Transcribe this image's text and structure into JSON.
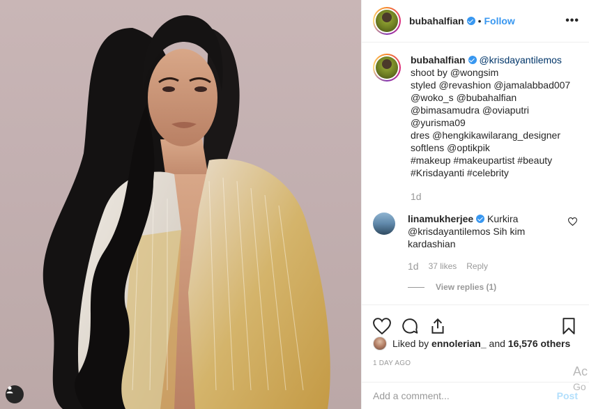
{
  "post": {
    "username": "bubahalfian",
    "follow_label": "Follow",
    "separator": "•",
    "more_label": "•••"
  },
  "caption": {
    "username": "bubahalfian",
    "lines": [
      "@krisdayantilemos",
      "shoot by @wongsim",
      "styled @revashion @jamalabbad007",
      "@woko_s @bubahalfian",
      "@bimasamudra @oviaputri",
      "@yurisma09",
      "dres @hengkikawilarang_designer",
      "softlens @optikpik",
      "#makeup #makeupartist #beauty",
      "#Krisdayanti #celebrity"
    ],
    "time": "1d"
  },
  "comment": {
    "username": "linamukherjee",
    "text_line1": "Kurkira",
    "text_line2": "@krisdayantilemos Sih kim",
    "text_line3": "kardashian",
    "time": "1d",
    "likes": "37 likes",
    "reply_label": "Reply",
    "view_replies": "View replies (1)"
  },
  "likes": {
    "prefix": "Liked by",
    "user": "ennolerian_",
    "and": "and",
    "count": "16,576 others"
  },
  "date": "1 DAY AGO",
  "add_comment": {
    "placeholder": "Add a comment...",
    "post_label": "Post"
  },
  "watermark": {
    "line1": "Ac",
    "line2": "Go"
  },
  "colors": {
    "link": "#3897f0",
    "mention": "#003569",
    "muted": "#999999",
    "post_disabled": "#b2dffc"
  },
  "icons": [
    "heart-icon",
    "comment-icon",
    "share-icon",
    "bookmark-icon",
    "more-icon",
    "verified-badge-icon",
    "user-tag-icon"
  ]
}
